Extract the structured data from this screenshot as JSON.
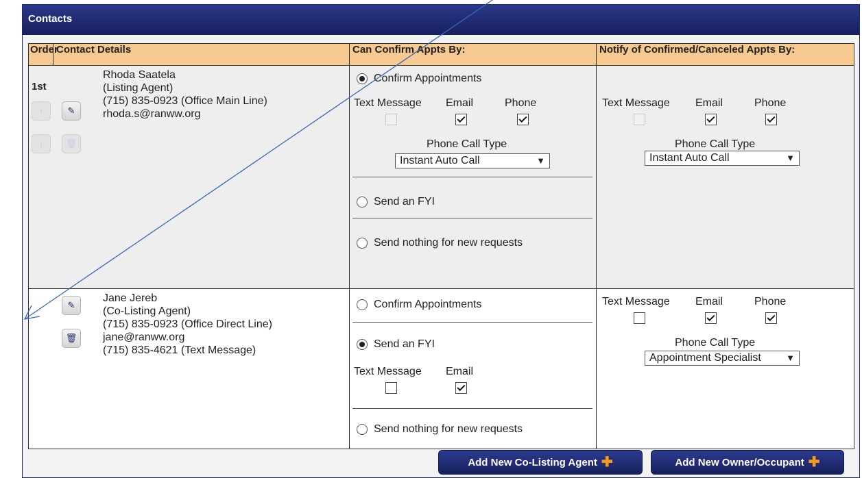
{
  "panel": {
    "title": "Contacts"
  },
  "columns": {
    "order": "Order",
    "details": "Contact Details",
    "confirm": "Can Confirm Appts By:",
    "notify": "Notify of Confirmed/Canceled Appts By:"
  },
  "contact1": {
    "order": "1st",
    "name": "Rhoda Saatela",
    "role": "(Listing Agent)",
    "phone": "(715) 835-0923 (Office Main Line)",
    "email": "rhoda.s@ranww.org",
    "confirm": {
      "option_confirm": "Confirm Appointments",
      "option_fyi": "Send an FYI",
      "option_nothing": "Send nothing for new requests",
      "selected": "Confirm Appointments",
      "text_label": "Text Message",
      "email_label": "Email",
      "phone_label": "Phone",
      "text_checked": false,
      "email_checked": true,
      "phone_checked": true,
      "call_type_label": "Phone Call Type",
      "call_type_value": "Instant Auto Call"
    },
    "notify": {
      "text_label": "Text Message",
      "email_label": "Email",
      "phone_label": "Phone",
      "text_checked": false,
      "email_checked": true,
      "phone_checked": true,
      "call_type_label": "Phone Call Type",
      "call_type_value": "Instant Auto Call"
    }
  },
  "contact2": {
    "name": "Jane Jereb",
    "role": "(Co-Listing Agent)",
    "phone": "(715) 835-0923 (Office Direct Line)",
    "email": "jane@ranww.org",
    "text_phone": "(715) 835-4621 (Text Message)",
    "confirm": {
      "option_confirm": "Confirm Appointments",
      "option_fyi": "Send an FYI",
      "option_nothing": "Send nothing for new requests",
      "selected": "Send an FYI",
      "text_label": "Text Message",
      "email_label": "Email",
      "text_checked": false,
      "email_checked": true
    },
    "notify": {
      "text_label": "Text Message",
      "email_label": "Email",
      "phone_label": "Phone",
      "text_checked": false,
      "email_checked": true,
      "phone_checked": true,
      "call_type_label": "Phone Call Type",
      "call_type_value": "Appointment Specialist"
    }
  },
  "buttons": {
    "add_co_listing": "Add New Co-Listing Agent",
    "add_owner": "Add New Owner/Occupant"
  },
  "icons": {
    "move_up": "arrow-up-icon",
    "move_down": "arrow-down-icon",
    "edit": "pencil-icon",
    "delete": "trash-icon",
    "add": "plus-icon"
  },
  "colors": {
    "header_bg": "#1f2a6e",
    "column_header_bg": "#f6c98e",
    "button_bg": "#1f2a6e",
    "plus_accent": "#f39a1f",
    "annotation_arrow": "#3a66b8"
  }
}
